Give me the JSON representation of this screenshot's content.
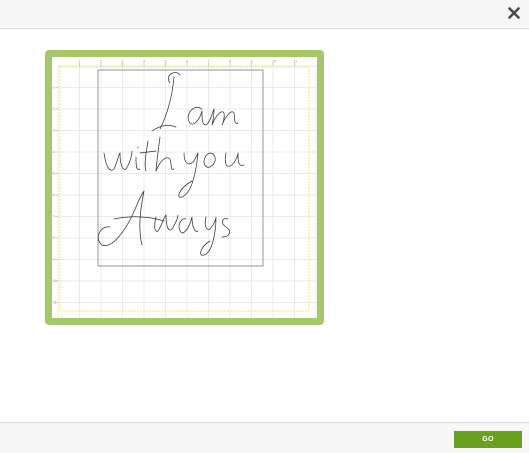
{
  "toolbar": {
    "close_icon": "close-icon"
  },
  "mat": {
    "frame_color": "#a6c86b",
    "grid_color": "#e3e3e3",
    "cut_area_color": "#e8ee6a",
    "ruler_top": [
      "1",
      "2",
      "3",
      "4",
      "5",
      "6",
      "7",
      "8",
      "9",
      "10",
      "11"
    ],
    "ruler_left": [
      "1",
      "2",
      "3",
      "4",
      "5",
      "6",
      "7",
      "8",
      "9",
      "10",
      "11"
    ]
  },
  "design": {
    "lines": [
      "I am",
      "with you",
      "Always"
    ]
  },
  "footer": {
    "go_label": "GO",
    "go_color": "#6aa21f"
  }
}
